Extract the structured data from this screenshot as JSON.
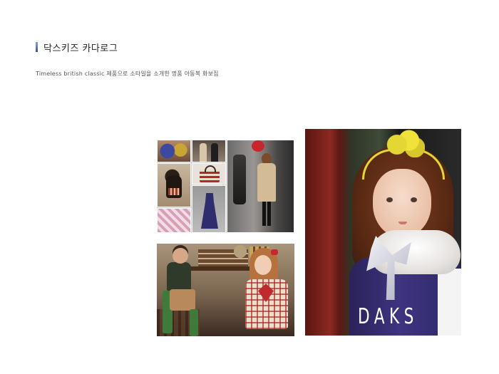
{
  "page": {
    "title": "닥스키즈 카다로그",
    "subtitle": "Timeless british classic 제품으로 소타일을 소개한 명품 아동복 화보집"
  },
  "images": {
    "collage": {
      "alt": "DAKS kids collage"
    },
    "bottom_photo": {
      "alt": "Boy and girl in plaid"
    },
    "main_photo": {
      "alt": "Girl in fur collar and bow",
      "brand_text": "DAKS"
    }
  },
  "colors": {
    "accent": "#3a4fa0",
    "title_text": "#222222",
    "subtitle_text": "#555555"
  }
}
